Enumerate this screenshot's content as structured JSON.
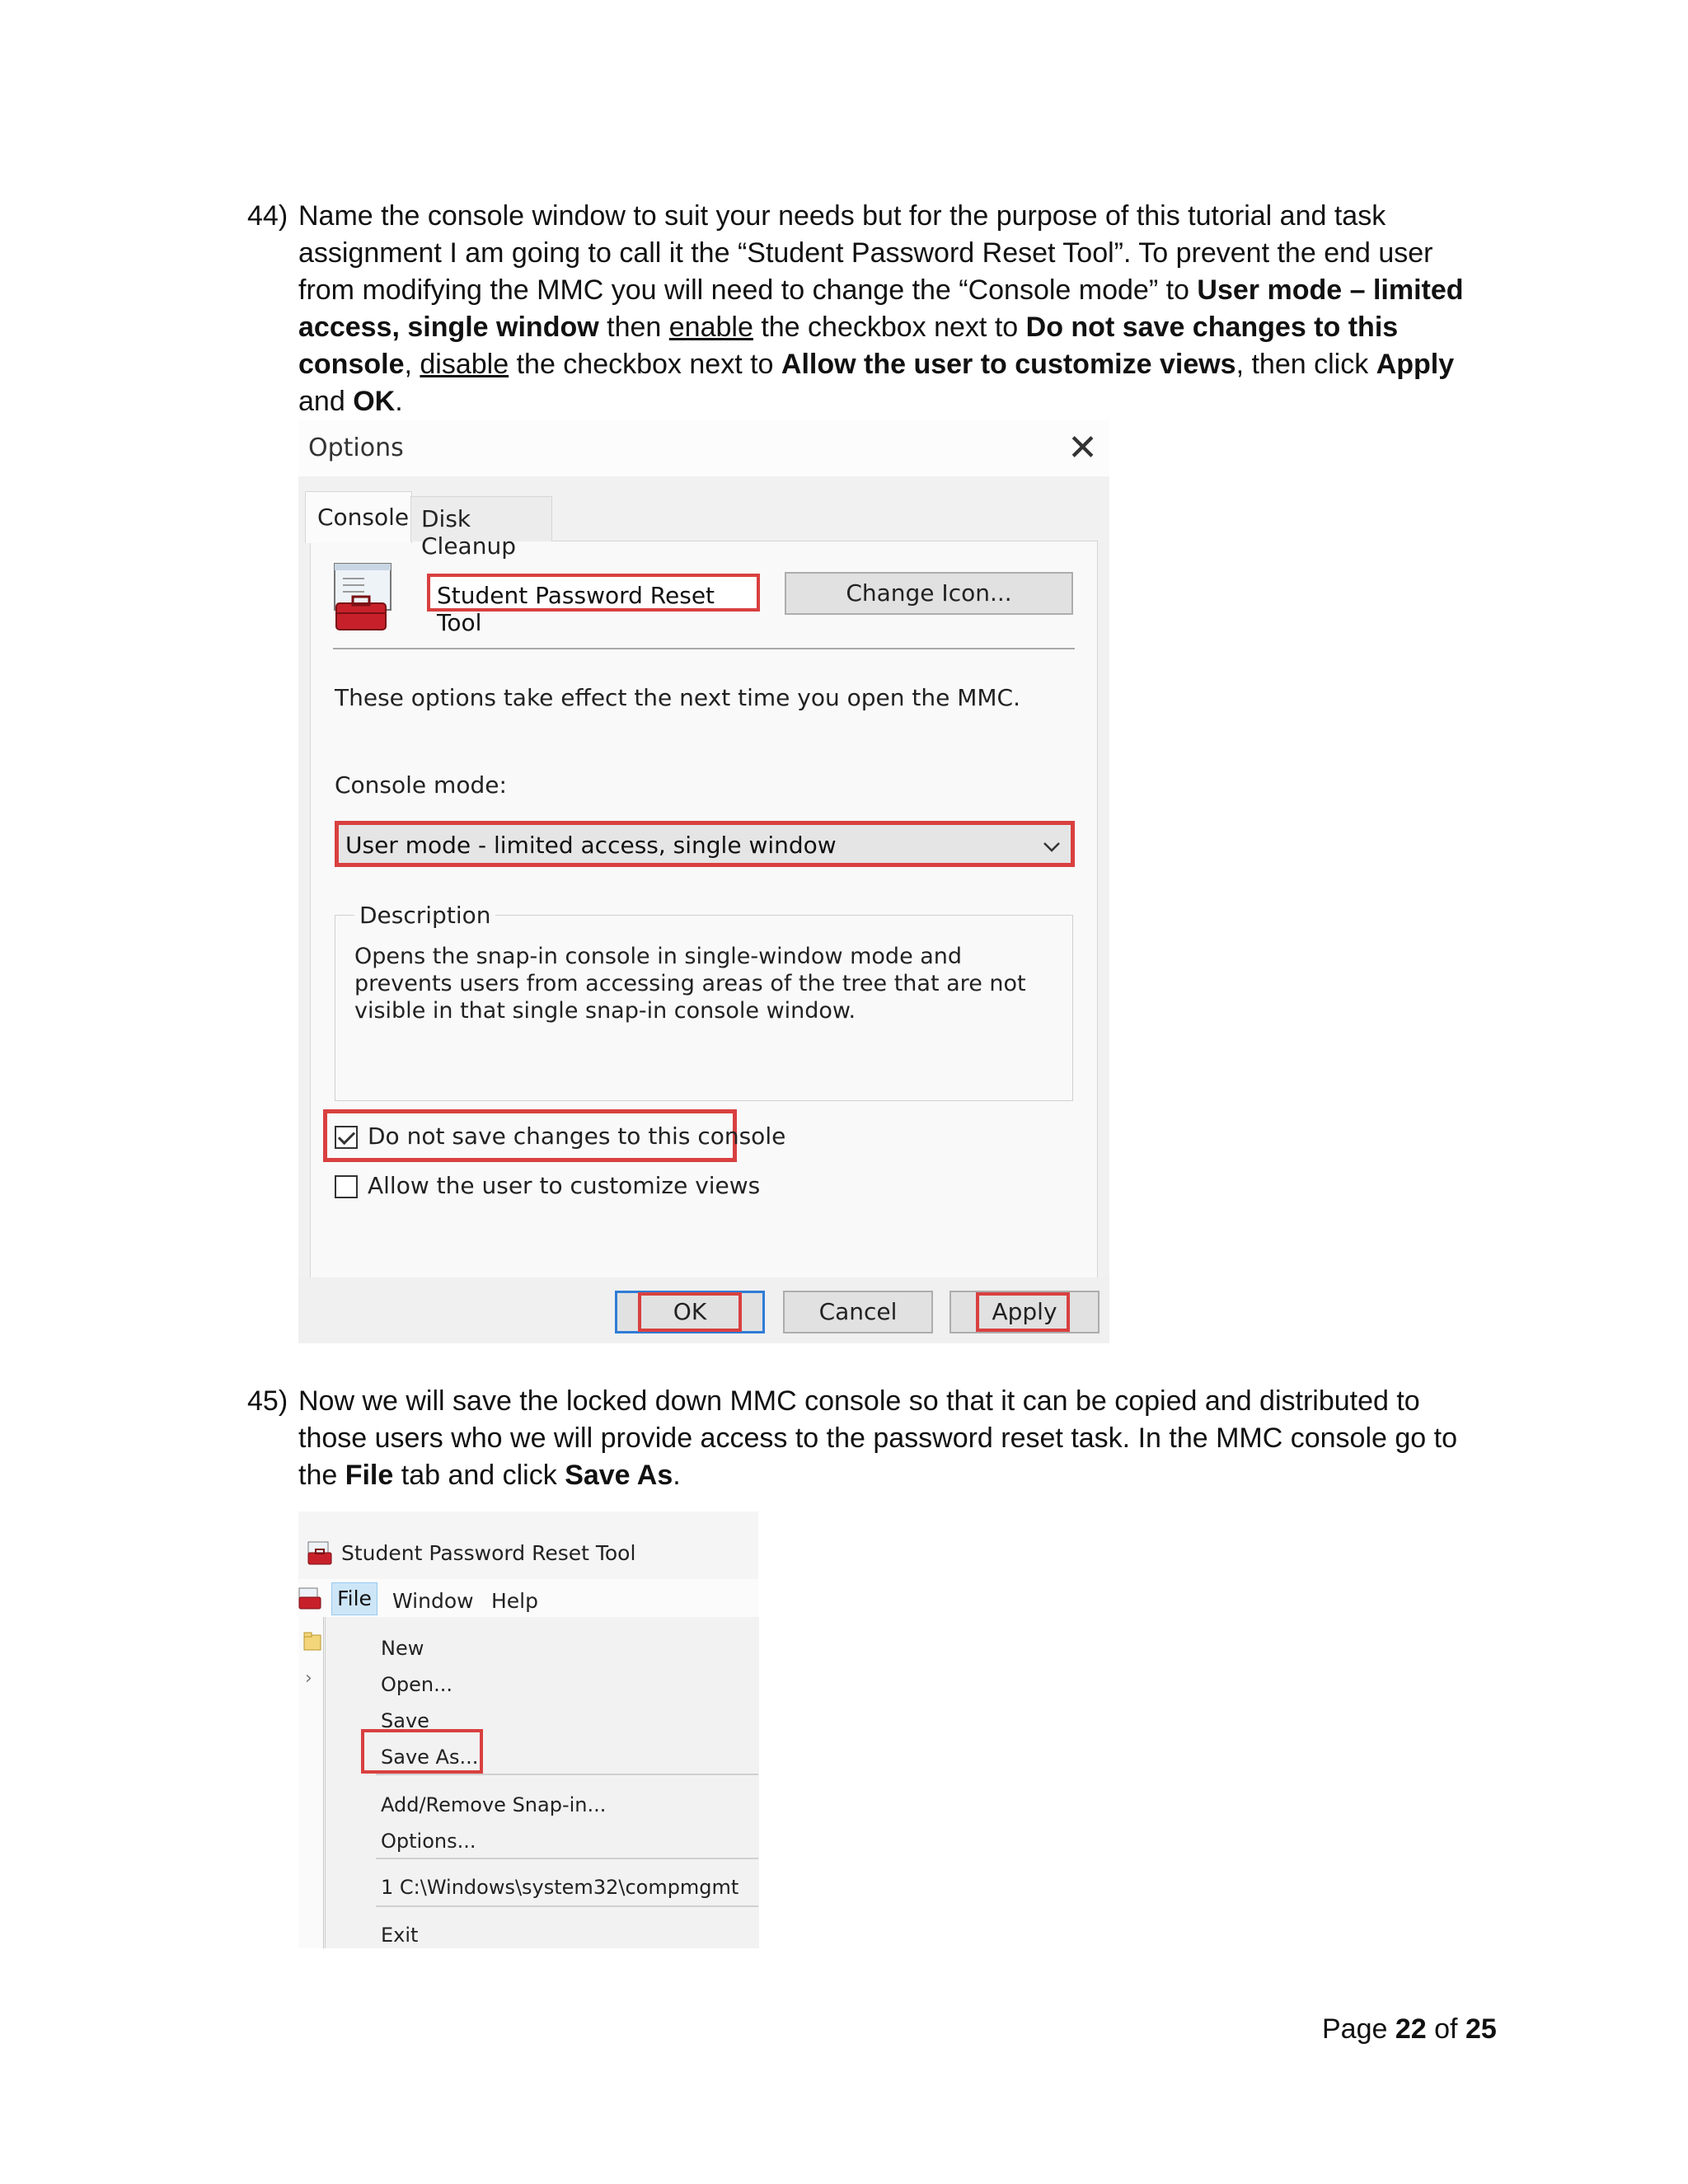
{
  "step44": {
    "number": "44)",
    "t1": "Name the console window to suit your needs but for the purpose of this tutorial and task assignment I am going to call it the “Student Password Reset Tool”. To prevent the end user from modifying the MMC you will need to change the “Console mode” to ",
    "b1": "User mode – limited access, single window",
    "t2": " then ",
    "u1": "enable",
    "t3": " the checkbox next to ",
    "b2": "Do not save changes to this console",
    "t4": ", ",
    "u2": "disable",
    "t5": " the checkbox next to ",
    "b3": "Allow the user to customize views",
    "t6": ", then click ",
    "b4": "Apply",
    "t7": " and ",
    "b5": "OK",
    "t8": "."
  },
  "options_dialog": {
    "title": "Options",
    "close_glyph": "✕",
    "tabs": [
      "Console",
      "Disk Cleanup"
    ],
    "console_name": "Student Password Reset Tool",
    "change_icon_label": "Change Icon...",
    "info_text": "These options take effect the next time you open the MMC.",
    "console_mode_label": "Console mode:",
    "console_mode_value": "User mode - limited access, single window",
    "description_label": "Description",
    "description_text": "Opens the snap-in console in single-window mode and prevents users from accessing areas of the tree that are not visible in that single snap-in console window.",
    "checkbox_no_save": {
      "label": "Do not save changes to this console",
      "checked": true
    },
    "checkbox_customize": {
      "label": "Allow the user to customize views",
      "checked": false
    },
    "ok_label": "OK",
    "cancel_label": "Cancel",
    "apply_label": "Apply",
    "highlight_color": "#d94040",
    "focus_color": "#2f7cd6"
  },
  "step45": {
    "number": "45)",
    "t1": "Now we will save the locked down MMC console so that it can be copied and distributed to those users who we will provide access to the password reset task. In the MMC console go to the ",
    "b1": "File",
    "t2": " tab and click ",
    "b2": "Save As",
    "t3": "."
  },
  "file_menu_shot": {
    "window_title": "Student Password Reset Tool",
    "menubar": [
      "File",
      "Window",
      "Help"
    ],
    "items": {
      "new": "New",
      "open": "Open...",
      "save": "Save",
      "save_as": "Save As...",
      "add_remove": "Add/Remove Snap-in...",
      "options": "Options...",
      "recent": "1 C:\\Windows\\system32\\compmgmt",
      "exit": "Exit"
    },
    "side_chevron": "›",
    "highlight_color": "#d94040"
  },
  "footer": {
    "prefix": "Page ",
    "current": "22",
    "mid": " of ",
    "total": "25"
  }
}
